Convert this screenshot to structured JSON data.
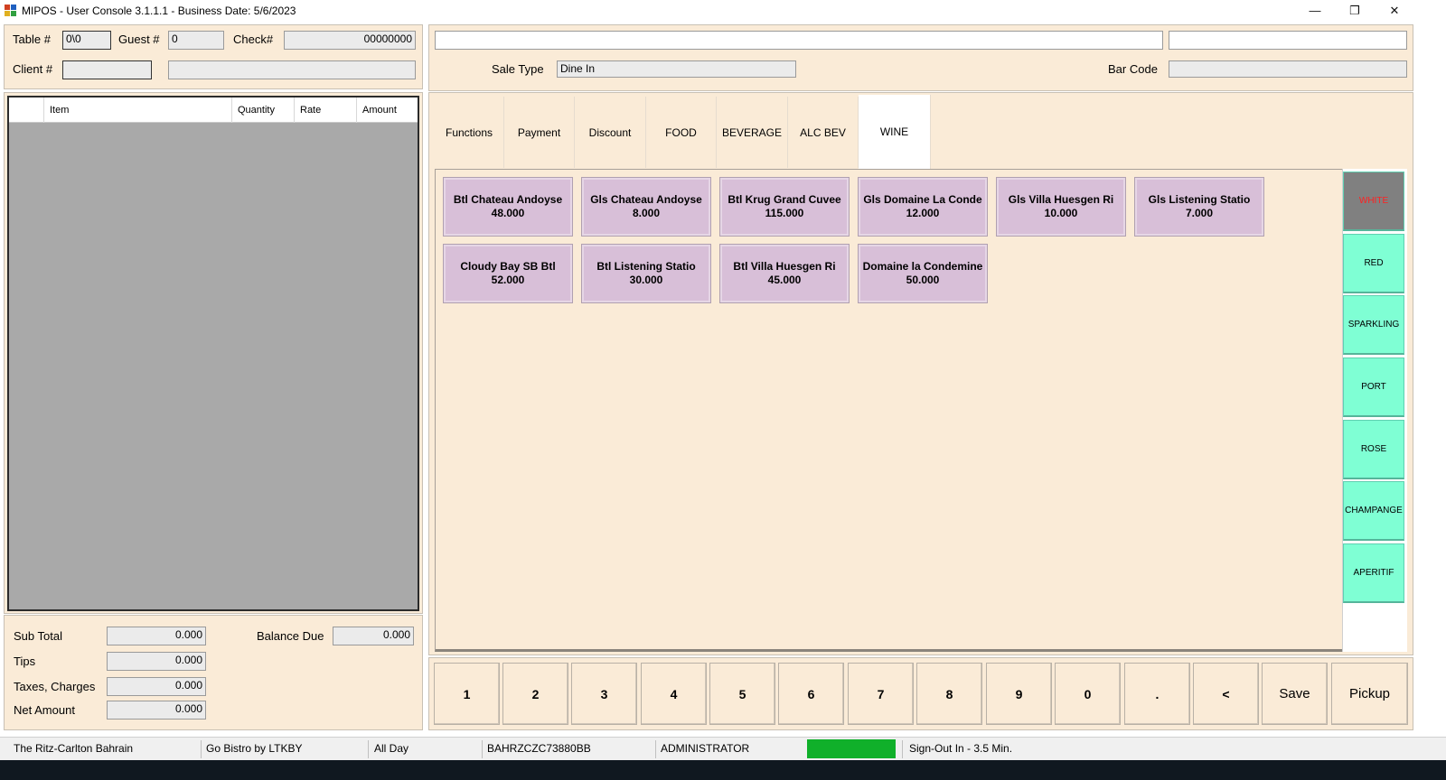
{
  "window": {
    "title": "MIPOS - User Console 3.1.1.1 - Business Date: 5/6/2023",
    "minimize": "—",
    "restore": "❐",
    "close": "✕"
  },
  "header": {
    "table_label": "Table #",
    "table_value": "0\\0",
    "guest_label": "Guest #",
    "guest_value": "0",
    "check_label": "Check#",
    "check_value": "00000000",
    "client_label": "Client #",
    "client_value": "",
    "client_name": ""
  },
  "order_grid": {
    "columns": [
      "Item",
      "Quantity",
      "Rate",
      "Amount"
    ]
  },
  "totals": {
    "subtotal_label": "Sub Total",
    "subtotal_value": "0.000",
    "tips_label": "Tips",
    "tips_value": "0.000",
    "taxes_label": "Taxes, Charges",
    "taxes_value": "0.000",
    "net_label": "Net Amount",
    "net_value": "0.000",
    "balance_label": "Balance Due",
    "balance_value": "0.000"
  },
  "top_right": {
    "field1": "",
    "field2": "",
    "sale_type_label": "Sale Type",
    "sale_type_value": "Dine In",
    "barcode_label": "Bar Code",
    "barcode_value": ""
  },
  "tabs": [
    "Functions",
    "Payment",
    "Discount",
    "FOOD",
    "BEVERAGE",
    "ALC BEV",
    "WINE"
  ],
  "active_tab": "WINE",
  "items": [
    {
      "name": "Btl Chateau Andoyse",
      "price": "48.000"
    },
    {
      "name": "Gls Chateau Andoyse",
      "price": "8.000"
    },
    {
      "name": "Btl Krug Grand Cuvee",
      "price": "115.000"
    },
    {
      "name": "Gls Domaine La Conde",
      "price": "12.000"
    },
    {
      "name": "Gls Villa Huesgen Ri",
      "price": "10.000"
    },
    {
      "name": "Gls Listening Statio",
      "price": "7.000"
    },
    {
      "name": "Cloudy Bay SB Btl",
      "price": "52.000"
    },
    {
      "name": "Btl Listening Statio",
      "price": "30.000"
    },
    {
      "name": "Btl Villa Huesgen Ri",
      "price": "45.000"
    },
    {
      "name": "Domaine la Condemine",
      "price": "50.000"
    }
  ],
  "categories": [
    "WHITE",
    "RED",
    "SPARKLING",
    "PORT",
    "ROSE",
    "CHAMPANGE",
    "APERITIF"
  ],
  "active_category": "WHITE",
  "numpad": [
    "1",
    "2",
    "3",
    "4",
    "5",
    "6",
    "7",
    "8",
    "9",
    "0",
    ".",
    "<",
    "Save",
    "Pickup"
  ],
  "status": {
    "property": "The Ritz-Carlton Bahrain",
    "outlet": "Go Bistro by LTKBY",
    "period": "All Day",
    "terminal": "BAHRZCZC73880BB",
    "user": "ADMINISTRATOR",
    "indicator_color": "#10b02a",
    "signout": "Sign-Out In - 3.5 Min."
  },
  "colors": {
    "panel_bg": "#faebd7",
    "item_bg": "#d8bfd8",
    "category_bg": "#7fffd4",
    "category_active_bg": "#808080",
    "category_active_text": "#ff2020"
  }
}
